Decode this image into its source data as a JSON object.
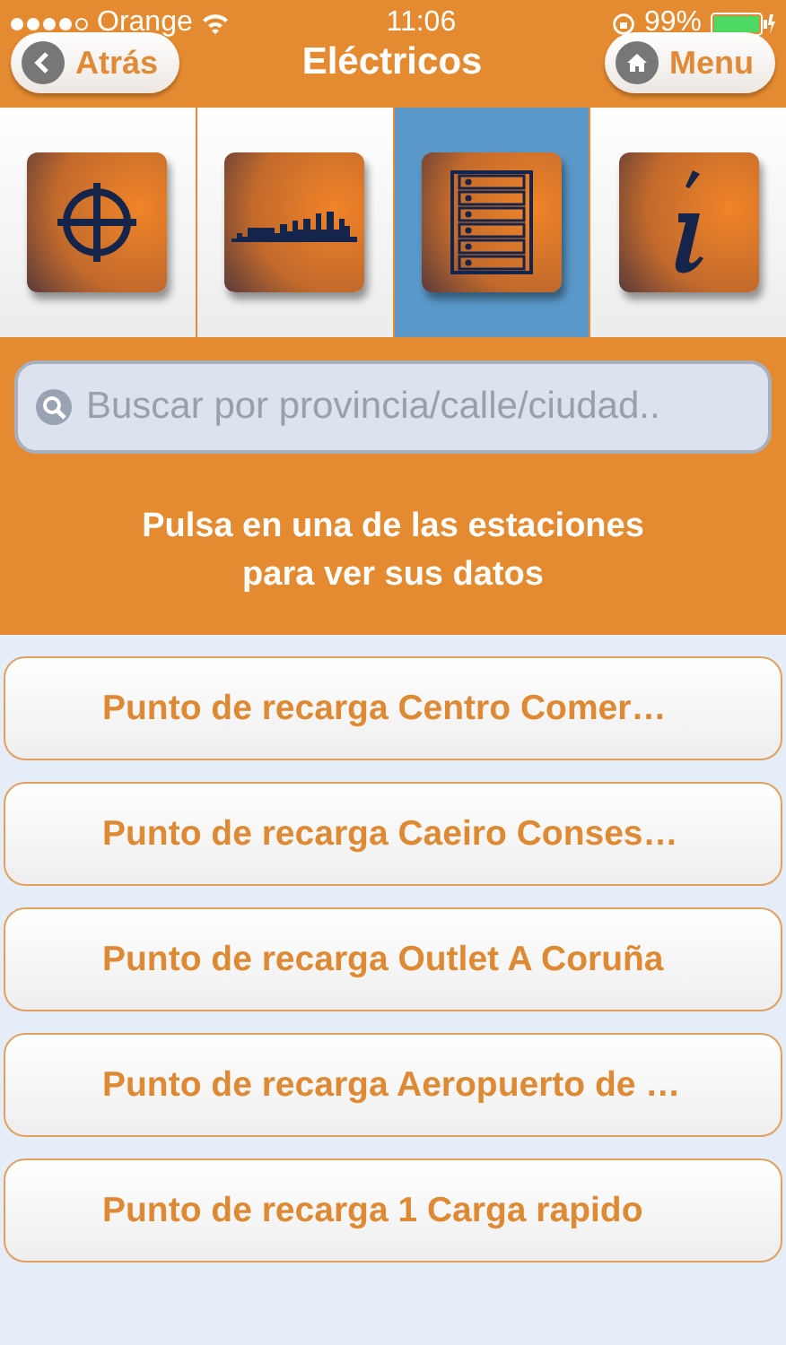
{
  "status_bar": {
    "carrier": "Orange",
    "time": "11:06",
    "battery": "99%"
  },
  "nav": {
    "back": "Atrás",
    "title": "Eléctricos",
    "menu": "Menu"
  },
  "tabs": [
    {
      "kind": "target",
      "selected": false
    },
    {
      "kind": "skyline",
      "selected": false
    },
    {
      "kind": "list",
      "selected": true
    },
    {
      "kind": "info",
      "selected": false
    }
  ],
  "search": {
    "placeholder": "Buscar por provincia/calle/ciudad.."
  },
  "hint": "Pulsa en una de las estaciones para ver sus datos",
  "stations": [
    {
      "name": "Punto de recarga Centro Comer…"
    },
    {
      "name": "Punto de recarga Caeiro Conses…"
    },
    {
      "name": "Punto de recarga Outlet A Coruña"
    },
    {
      "name": "Punto de recarga Aeropuerto de …"
    },
    {
      "name": "Punto de recarga 1 Carga rapido"
    }
  ]
}
